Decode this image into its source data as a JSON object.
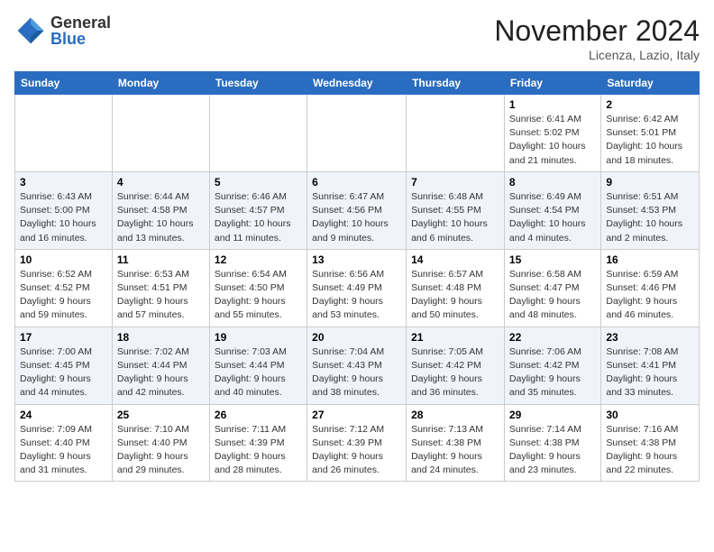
{
  "header": {
    "logo_general": "General",
    "logo_blue": "Blue",
    "month_title": "November 2024",
    "location": "Licenza, Lazio, Italy"
  },
  "weekdays": [
    "Sunday",
    "Monday",
    "Tuesday",
    "Wednesday",
    "Thursday",
    "Friday",
    "Saturday"
  ],
  "weeks": [
    [
      {
        "day": "",
        "info": ""
      },
      {
        "day": "",
        "info": ""
      },
      {
        "day": "",
        "info": ""
      },
      {
        "day": "",
        "info": ""
      },
      {
        "day": "",
        "info": ""
      },
      {
        "day": "1",
        "info": "Sunrise: 6:41 AM\nSunset: 5:02 PM\nDaylight: 10 hours\nand 21 minutes."
      },
      {
        "day": "2",
        "info": "Sunrise: 6:42 AM\nSunset: 5:01 PM\nDaylight: 10 hours\nand 18 minutes."
      }
    ],
    [
      {
        "day": "3",
        "info": "Sunrise: 6:43 AM\nSunset: 5:00 PM\nDaylight: 10 hours\nand 16 minutes."
      },
      {
        "day": "4",
        "info": "Sunrise: 6:44 AM\nSunset: 4:58 PM\nDaylight: 10 hours\nand 13 minutes."
      },
      {
        "day": "5",
        "info": "Sunrise: 6:46 AM\nSunset: 4:57 PM\nDaylight: 10 hours\nand 11 minutes."
      },
      {
        "day": "6",
        "info": "Sunrise: 6:47 AM\nSunset: 4:56 PM\nDaylight: 10 hours\nand 9 minutes."
      },
      {
        "day": "7",
        "info": "Sunrise: 6:48 AM\nSunset: 4:55 PM\nDaylight: 10 hours\nand 6 minutes."
      },
      {
        "day": "8",
        "info": "Sunrise: 6:49 AM\nSunset: 4:54 PM\nDaylight: 10 hours\nand 4 minutes."
      },
      {
        "day": "9",
        "info": "Sunrise: 6:51 AM\nSunset: 4:53 PM\nDaylight: 10 hours\nand 2 minutes."
      }
    ],
    [
      {
        "day": "10",
        "info": "Sunrise: 6:52 AM\nSunset: 4:52 PM\nDaylight: 9 hours\nand 59 minutes."
      },
      {
        "day": "11",
        "info": "Sunrise: 6:53 AM\nSunset: 4:51 PM\nDaylight: 9 hours\nand 57 minutes."
      },
      {
        "day": "12",
        "info": "Sunrise: 6:54 AM\nSunset: 4:50 PM\nDaylight: 9 hours\nand 55 minutes."
      },
      {
        "day": "13",
        "info": "Sunrise: 6:56 AM\nSunset: 4:49 PM\nDaylight: 9 hours\nand 53 minutes."
      },
      {
        "day": "14",
        "info": "Sunrise: 6:57 AM\nSunset: 4:48 PM\nDaylight: 9 hours\nand 50 minutes."
      },
      {
        "day": "15",
        "info": "Sunrise: 6:58 AM\nSunset: 4:47 PM\nDaylight: 9 hours\nand 48 minutes."
      },
      {
        "day": "16",
        "info": "Sunrise: 6:59 AM\nSunset: 4:46 PM\nDaylight: 9 hours\nand 46 minutes."
      }
    ],
    [
      {
        "day": "17",
        "info": "Sunrise: 7:00 AM\nSunset: 4:45 PM\nDaylight: 9 hours\nand 44 minutes."
      },
      {
        "day": "18",
        "info": "Sunrise: 7:02 AM\nSunset: 4:44 PM\nDaylight: 9 hours\nand 42 minutes."
      },
      {
        "day": "19",
        "info": "Sunrise: 7:03 AM\nSunset: 4:44 PM\nDaylight: 9 hours\nand 40 minutes."
      },
      {
        "day": "20",
        "info": "Sunrise: 7:04 AM\nSunset: 4:43 PM\nDaylight: 9 hours\nand 38 minutes."
      },
      {
        "day": "21",
        "info": "Sunrise: 7:05 AM\nSunset: 4:42 PM\nDaylight: 9 hours\nand 36 minutes."
      },
      {
        "day": "22",
        "info": "Sunrise: 7:06 AM\nSunset: 4:42 PM\nDaylight: 9 hours\nand 35 minutes."
      },
      {
        "day": "23",
        "info": "Sunrise: 7:08 AM\nSunset: 4:41 PM\nDaylight: 9 hours\nand 33 minutes."
      }
    ],
    [
      {
        "day": "24",
        "info": "Sunrise: 7:09 AM\nSunset: 4:40 PM\nDaylight: 9 hours\nand 31 minutes."
      },
      {
        "day": "25",
        "info": "Sunrise: 7:10 AM\nSunset: 4:40 PM\nDaylight: 9 hours\nand 29 minutes."
      },
      {
        "day": "26",
        "info": "Sunrise: 7:11 AM\nSunset: 4:39 PM\nDaylight: 9 hours\nand 28 minutes."
      },
      {
        "day": "27",
        "info": "Sunrise: 7:12 AM\nSunset: 4:39 PM\nDaylight: 9 hours\nand 26 minutes."
      },
      {
        "day": "28",
        "info": "Sunrise: 7:13 AM\nSunset: 4:38 PM\nDaylight: 9 hours\nand 24 minutes."
      },
      {
        "day": "29",
        "info": "Sunrise: 7:14 AM\nSunset: 4:38 PM\nDaylight: 9 hours\nand 23 minutes."
      },
      {
        "day": "30",
        "info": "Sunrise: 7:16 AM\nSunset: 4:38 PM\nDaylight: 9 hours\nand 22 minutes."
      }
    ]
  ]
}
